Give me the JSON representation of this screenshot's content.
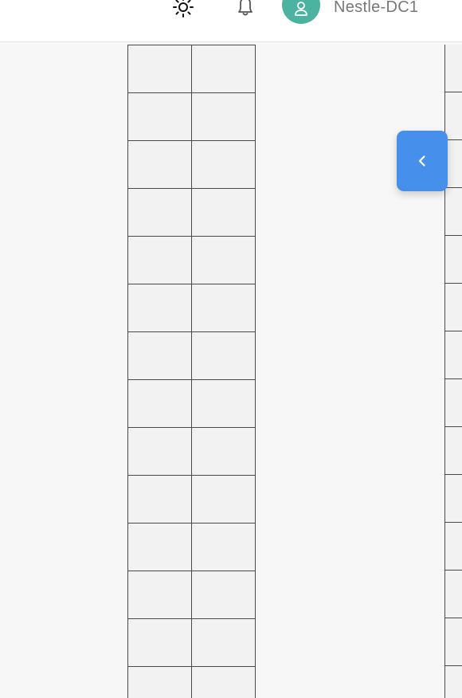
{
  "header": {
    "theme_icon": "sun-icon",
    "notification_icon": "bell-icon",
    "avatar_icon": "user-icon",
    "username": "Nestle-DC1"
  },
  "sidebar_toggle": {
    "icon": "chevron-left-icon"
  },
  "layout_grid": {
    "columns": 2,
    "rows": 14,
    "right_panel_rows": 14
  },
  "colors": {
    "accent": "#4690ec",
    "avatar_bg": "#4cb3a0",
    "grid_line": "#4a4a4a",
    "cell_bg": "#f2f2f2",
    "page_bg": "#f7f7f7"
  }
}
